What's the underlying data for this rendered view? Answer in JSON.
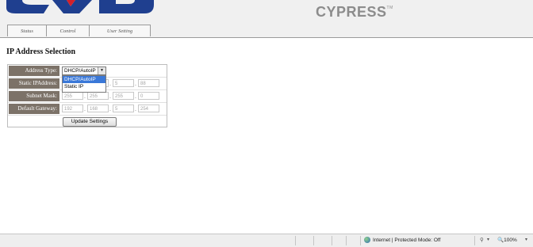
{
  "header": {
    "brand": "CYPRESS",
    "logo_colors": {
      "blue": "#1f3f8f",
      "red": "#d4202a"
    },
    "tabs": [
      {
        "label": "Status"
      },
      {
        "label": "Control"
      },
      {
        "label": "User Setting"
      }
    ]
  },
  "page": {
    "title": "IP Address Selection"
  },
  "form": {
    "address_type": {
      "label": "Address Type:",
      "selected": "DHCP/AutoIP",
      "options": [
        "DHCP/AutoIP",
        "Static IP"
      ]
    },
    "static_ip": {
      "label": "Static IPAddress:",
      "octets": [
        "",
        "",
        "5",
        "88"
      ]
    },
    "subnet_mask": {
      "label": "Subnet Mask:",
      "octets": [
        "255",
        "255",
        "255",
        "0"
      ]
    },
    "default_gateway": {
      "label": "Default Gateway:",
      "octets": [
        "192",
        "168",
        "5",
        "254"
      ]
    },
    "update_button": "Update Settings"
  },
  "statusbar": {
    "zone": "Internet | Protected Mode: Off",
    "zoom": "100%"
  }
}
